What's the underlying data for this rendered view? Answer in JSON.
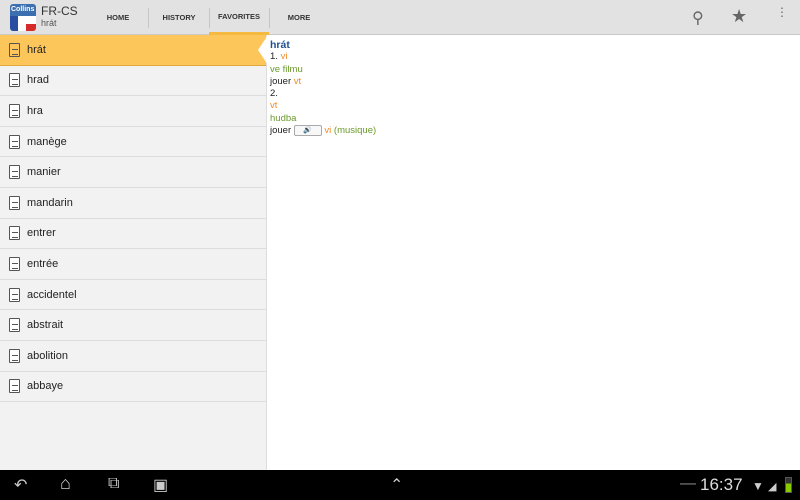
{
  "app": {
    "title": "FR-CS",
    "subtitle": "hrát",
    "logo_text": "Collins"
  },
  "tabs": [
    {
      "label": "HOME"
    },
    {
      "label": "HISTORY"
    },
    {
      "label": "FAVORITES",
      "active": true
    },
    {
      "label": "MORE"
    }
  ],
  "toolbar_icons": [
    "search-icon",
    "star-icon",
    "overflow-menu-icon"
  ],
  "list": [
    "hrát",
    "hrad",
    "hra",
    "manège",
    "manier",
    "mandarin",
    "entrer",
    "entrée",
    "accidentel",
    "abstrait",
    "abolition",
    "abbaye"
  ],
  "entry": {
    "headword": "hrát",
    "n1": "1.",
    "pos1": "vi",
    "ex1": "ve filmu",
    "tr1": "jouer",
    "tr1pos": "vt",
    "n2": "2.",
    "pos2": "vt",
    "ex2": "hudba",
    "tr2": "jouer",
    "tr2pos": "vi",
    "tr2note": "(musique)",
    "speaker": "🔊"
  },
  "status": {
    "time": "16:37"
  },
  "colors": {
    "accent": "#fdc65a",
    "headword": "#1f4f8f",
    "pos": "#f08a24",
    "example": "#6a9a2a"
  }
}
